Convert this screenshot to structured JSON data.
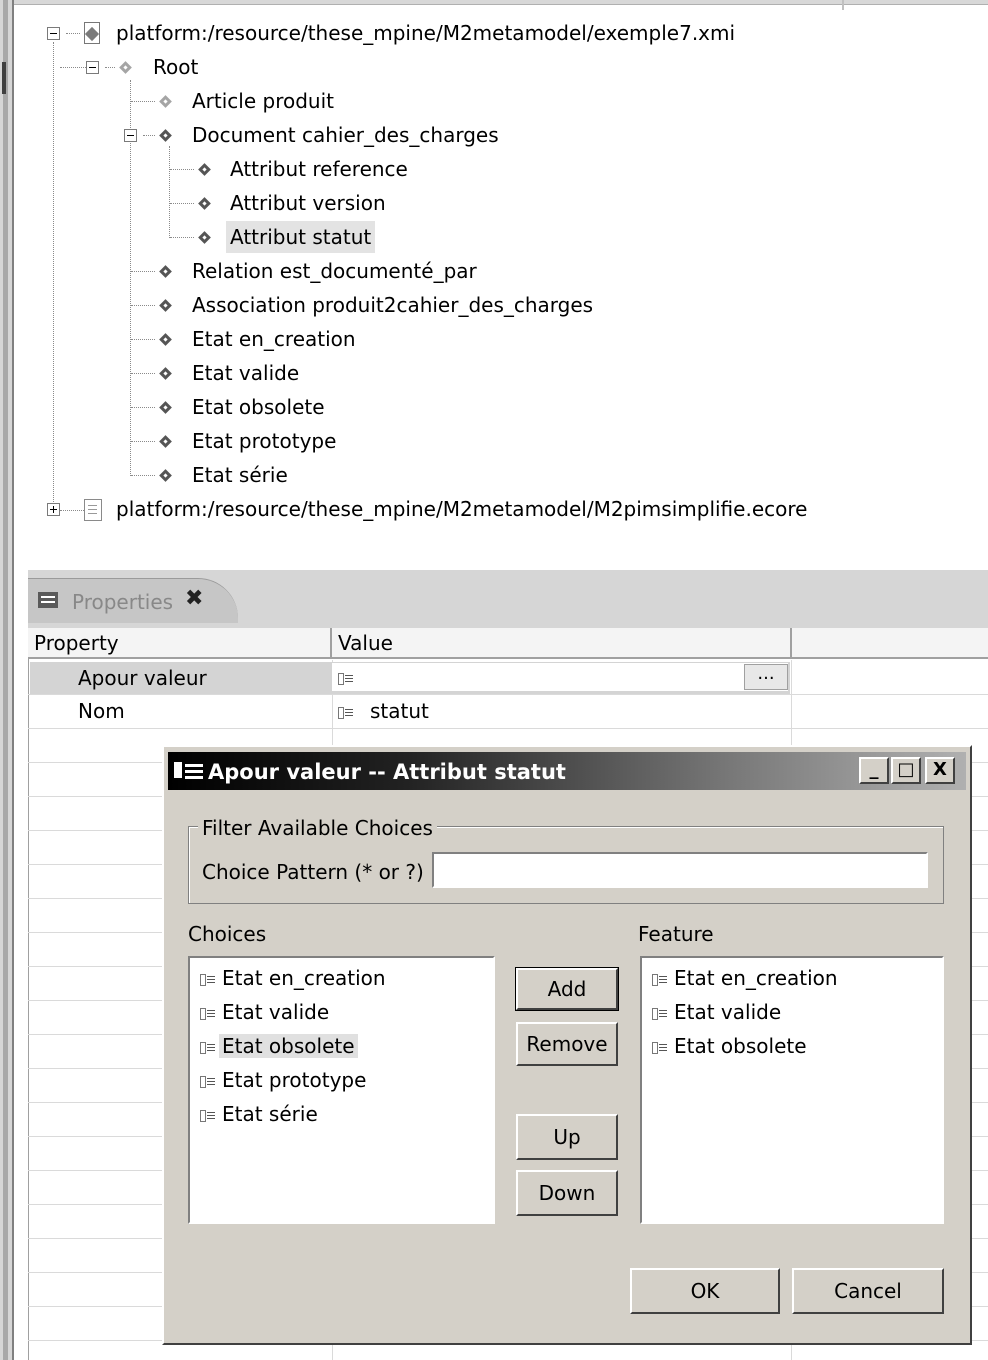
{
  "tree": {
    "root_file": "platform:/resource/these_mpine/M2metamodel/exemple7.xmi",
    "root_node": "Root",
    "items": [
      "Article produit",
      "Document cahier_des_charges",
      "Attribut reference",
      "Attribut version",
      "Attribut statut",
      "Relation est_documenté_par",
      "Association produit2cahier_des_charges",
      "Etat en_creation",
      "Etat valide",
      "Etat obsolete",
      "Etat prototype",
      "Etat série"
    ],
    "second_file": "platform:/resource/these_mpine/M2metamodel/M2pimsimplifie.ecore"
  },
  "properties": {
    "tab_title": "Properties",
    "close_glyph": "✖",
    "col_property": "Property",
    "col_value": "Value",
    "rows": [
      {
        "property": "Apour valeur",
        "value": ""
      },
      {
        "property": "Nom",
        "value": "statut"
      }
    ],
    "ellipsis": "..."
  },
  "dialog": {
    "title": "Apour valeur -- Attribut statut",
    "minimize": "_",
    "maximize": "□",
    "close": "X",
    "filter_group": "Filter Available Choices",
    "pattern_label": "Choice Pattern (* or ?)",
    "pattern_value": "",
    "choices_label": "Choices",
    "feature_label": "Feature",
    "choices": [
      "Etat en_creation",
      "Etat valide",
      "Etat obsolete",
      "Etat prototype",
      "Etat série"
    ],
    "features": [
      "Etat en_creation",
      "Etat valide",
      "Etat obsolete"
    ],
    "add": "Add",
    "remove": "Remove",
    "up": "Up",
    "down": "Down",
    "ok": "OK",
    "cancel": "Cancel"
  }
}
